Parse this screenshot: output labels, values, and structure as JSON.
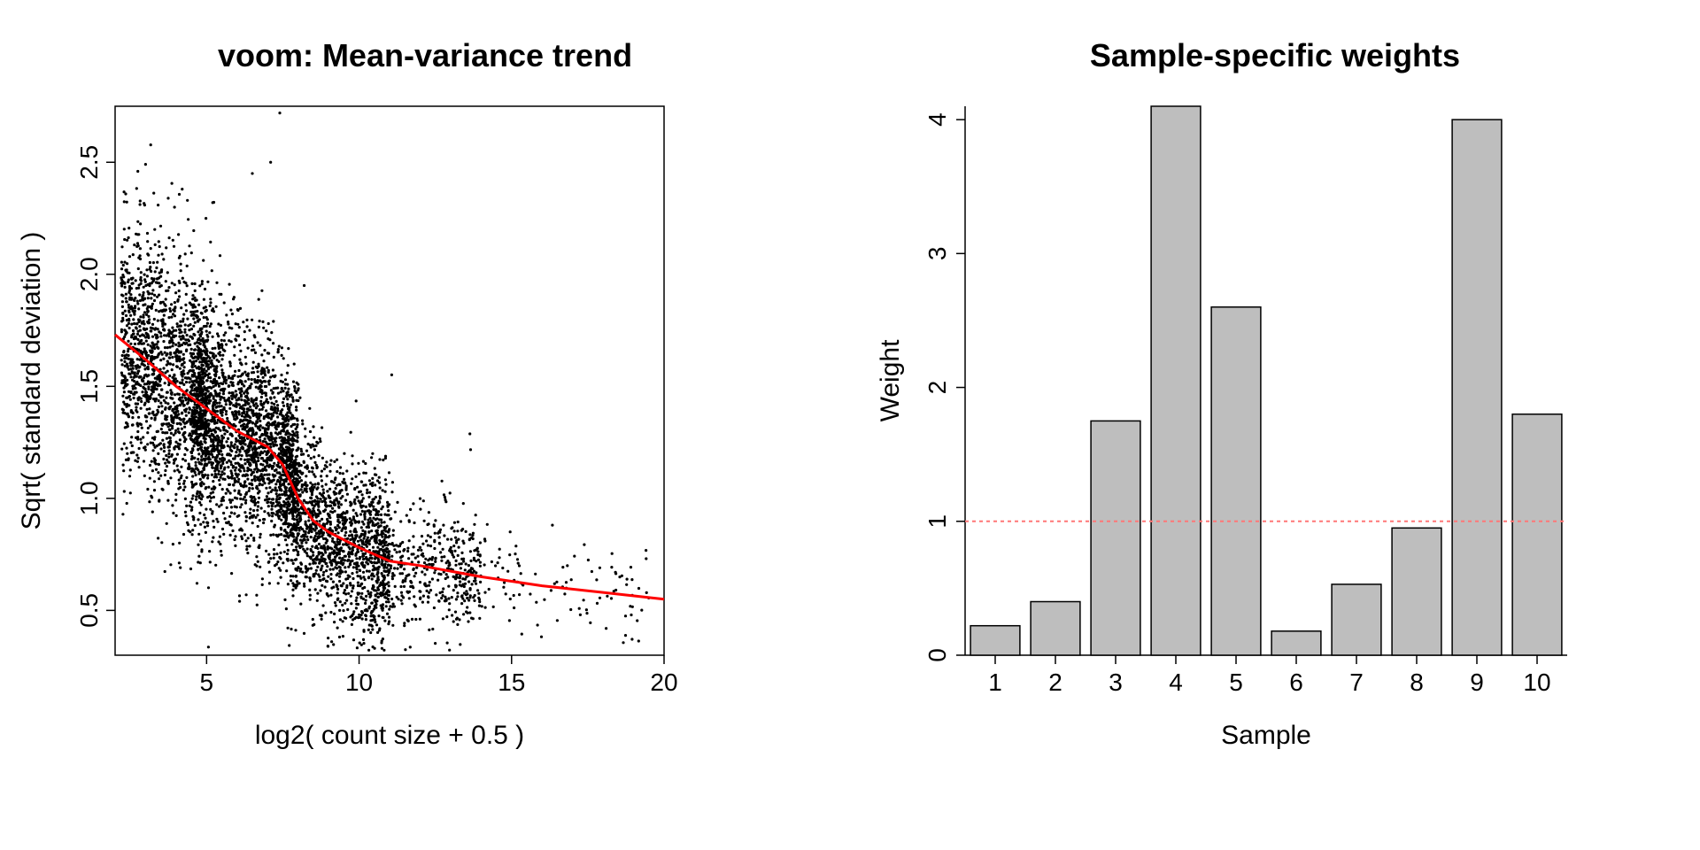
{
  "chart_data": [
    {
      "type": "scatter",
      "title": "voom: Mean-variance trend",
      "xlabel": "log2( count size + 0.5 )",
      "ylabel": "Sqrt( standard deviation )",
      "xlim": [
        2,
        20
      ],
      "ylim": [
        0.3,
        2.75
      ],
      "x_ticks": [
        5,
        10,
        15,
        20
      ],
      "y_ticks": [
        0.5,
        1.0,
        1.5,
        2.0,
        2.5
      ],
      "trend_line": {
        "x": [
          2.0,
          3.0,
          4.0,
          5.0,
          6.0,
          7.0,
          7.5,
          8.0,
          8.5,
          9.0,
          10.0,
          11.0,
          12.0,
          14.0,
          16.0,
          18.0,
          20.0
        ],
        "y": [
          1.73,
          1.62,
          1.5,
          1.4,
          1.3,
          1.23,
          1.15,
          1.0,
          0.9,
          0.85,
          0.78,
          0.72,
          0.7,
          0.65,
          0.61,
          0.58,
          0.55
        ],
        "color": "#ff0000"
      },
      "point_density_note": "dense scatter of ~5000 points following decreasing trend with spread; values estimated from pixels"
    },
    {
      "type": "bar",
      "title": "Sample-specific weights",
      "xlabel": "Sample",
      "ylabel": "Weight",
      "xlim": [
        0.5,
        10.5
      ],
      "ylim": [
        0,
        4.1
      ],
      "x_ticks": [
        1,
        2,
        3,
        4,
        5,
        6,
        7,
        8,
        9,
        10
      ],
      "y_ticks": [
        0,
        1,
        2,
        3,
        4
      ],
      "categories": [
        "1",
        "2",
        "3",
        "4",
        "5",
        "6",
        "7",
        "8",
        "9",
        "10"
      ],
      "values": [
        0.22,
        0.4,
        1.75,
        4.1,
        2.6,
        0.18,
        0.53,
        0.95,
        4.0,
        1.8
      ],
      "bar_fill": "#bebebe",
      "bar_stroke": "#000000",
      "reference_line": {
        "y": 1.0,
        "color": "#ff7777",
        "dash": "4 4"
      }
    }
  ],
  "left": {
    "title": "voom: Mean-variance trend",
    "xlabel": "log2( count size + 0.5 )",
    "ylabel": "Sqrt( standard deviation )"
  },
  "right": {
    "title": "Sample-specific weights",
    "xlabel": "Sample",
    "ylabel": "Weight"
  }
}
